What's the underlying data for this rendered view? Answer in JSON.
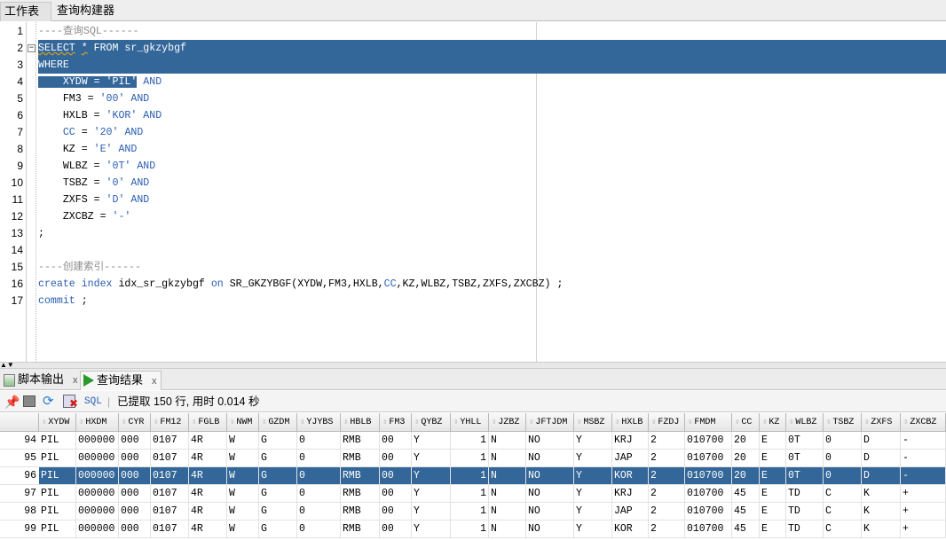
{
  "top_tabs": [
    "工作表",
    "查询构建器"
  ],
  "editor": {
    "lines": [
      {
        "n": "1",
        "tokens": [
          [
            "----查询SQL------",
            "cm"
          ]
        ]
      },
      {
        "n": "2",
        "sel": "full",
        "fold": true,
        "tokens": [
          [
            "SELECT",
            "kw w"
          ],
          [
            " ",
            "tx"
          ],
          [
            "*",
            "tx w"
          ],
          [
            " FROM sr_gkzybgf",
            "kw"
          ]
        ]
      },
      {
        "n": "3",
        "sel": "full",
        "tokens": [
          [
            "WHERE",
            "kw"
          ]
        ]
      },
      {
        "n": "4",
        "tokens": [
          [
            "    XYDW = 'PIL'",
            "tx s"
          ],
          [
            " AND",
            "kw"
          ]
        ]
      },
      {
        "n": "5",
        "tokens": [
          [
            "    FM3 = ",
            "tx"
          ],
          [
            "'00'",
            "st"
          ],
          [
            " AND",
            "kw"
          ]
        ]
      },
      {
        "n": "6",
        "tokens": [
          [
            "    HXLB = ",
            "tx"
          ],
          [
            "'KOR'",
            "st"
          ],
          [
            " AND",
            "kw"
          ]
        ]
      },
      {
        "n": "7",
        "tokens": [
          [
            "    ",
            "tx"
          ],
          [
            "CC",
            "kw"
          ],
          [
            " = ",
            "tx"
          ],
          [
            "'20'",
            "st"
          ],
          [
            " AND",
            "kw"
          ]
        ]
      },
      {
        "n": "8",
        "tokens": [
          [
            "    KZ = ",
            "tx"
          ],
          [
            "'E'",
            "st"
          ],
          [
            " AND",
            "kw"
          ]
        ]
      },
      {
        "n": "9",
        "tokens": [
          [
            "    WLBZ = ",
            "tx"
          ],
          [
            "'0T'",
            "st"
          ],
          [
            " AND",
            "kw"
          ]
        ]
      },
      {
        "n": "10",
        "tokens": [
          [
            "    TSBZ = ",
            "tx"
          ],
          [
            "'0'",
            "st"
          ],
          [
            " AND",
            "kw"
          ]
        ]
      },
      {
        "n": "11",
        "tokens": [
          [
            "    ZXFS = ",
            "tx"
          ],
          [
            "'D'",
            "st"
          ],
          [
            " AND",
            "kw"
          ]
        ]
      },
      {
        "n": "12",
        "tokens": [
          [
            "    ZXCBZ = ",
            "tx"
          ],
          [
            "'-'",
            "st"
          ]
        ]
      },
      {
        "n": "13",
        "tokens": [
          [
            ";",
            "tx"
          ]
        ]
      },
      {
        "n": "14",
        "tokens": []
      },
      {
        "n": "15",
        "tokens": [
          [
            "----创建索引------",
            "cm"
          ]
        ]
      },
      {
        "n": "16",
        "tokens": [
          [
            "create index",
            "kw"
          ],
          [
            " idx_sr_gkzybgf ",
            "tx"
          ],
          [
            "on",
            "kw"
          ],
          [
            " SR_GKZYBGF(XYDW,FM3,HXLB,",
            "tx"
          ],
          [
            "CC",
            "kw"
          ],
          [
            ",KZ,WLBZ,TSBZ,ZXFS,ZXCBZ) ;",
            "tx"
          ]
        ]
      },
      {
        "n": "17",
        "tokens": [
          [
            "commit",
            "kw"
          ],
          [
            " ;",
            "tx"
          ]
        ]
      }
    ]
  },
  "bottom_tabs": [
    {
      "label": "脚本输出",
      "close": "x"
    },
    {
      "label": "查询结果",
      "close": "x"
    }
  ],
  "toolbar": {
    "sql": "SQL",
    "status": "已提取 150 行, 用时 0.014 秒"
  },
  "results": {
    "columns": [
      "XYDW",
      "HXDM",
      "CYR",
      "FM12",
      "FGLB",
      "NWM",
      "GZDM",
      "YJYBS",
      "HBLB",
      "FM3",
      "QYBZ",
      "YHLL",
      "JZBZ",
      "JFTJDM",
      "MSBZ",
      "HXLB",
      "FZDJ",
      "FMDM",
      "CC",
      "KZ",
      "WLBZ",
      "TSBZ",
      "ZXFS",
      "ZXCBZ"
    ],
    "selected_row": "96",
    "rows": [
      {
        "n": "94",
        "v": [
          "PIL",
          "000000",
          "000",
          "0107",
          "4R",
          "W",
          "G",
          "0",
          "RMB",
          "00",
          "Y",
          "1",
          "N",
          "NO",
          "Y",
          "KRJ",
          "2",
          "010700",
          "20",
          "E",
          "0T",
          "0",
          "D",
          "-"
        ]
      },
      {
        "n": "95",
        "v": [
          "PIL",
          "000000",
          "000",
          "0107",
          "4R",
          "W",
          "G",
          "0",
          "RMB",
          "00",
          "Y",
          "1",
          "N",
          "NO",
          "Y",
          "JAP",
          "2",
          "010700",
          "20",
          "E",
          "0T",
          "0",
          "D",
          "-"
        ]
      },
      {
        "n": "96",
        "v": [
          "PIL",
          "000000",
          "000",
          "0107",
          "4R",
          "W",
          "G",
          "0",
          "RMB",
          "00",
          "Y",
          "1",
          "N",
          "NO",
          "Y",
          "KOR",
          "2",
          "010700",
          "20",
          "E",
          "0T",
          "0",
          "D",
          "-"
        ]
      },
      {
        "n": "97",
        "v": [
          "PIL",
          "000000",
          "000",
          "0107",
          "4R",
          "W",
          "G",
          "0",
          "RMB",
          "00",
          "Y",
          "1",
          "N",
          "NO",
          "Y",
          "KRJ",
          "2",
          "010700",
          "45",
          "E",
          "TD",
          "C",
          "K",
          "+"
        ]
      },
      {
        "n": "98",
        "v": [
          "PIL",
          "000000",
          "000",
          "0107",
          "4R",
          "W",
          "G",
          "0",
          "RMB",
          "00",
          "Y",
          "1",
          "N",
          "NO",
          "Y",
          "JAP",
          "2",
          "010700",
          "45",
          "E",
          "TD",
          "C",
          "K",
          "+"
        ]
      },
      {
        "n": "99",
        "v": [
          "PIL",
          "000000",
          "000",
          "0107",
          "4R",
          "W",
          "G",
          "0",
          "RMB",
          "00",
          "Y",
          "1",
          "N",
          "NO",
          "Y",
          "KOR",
          "2",
          "010700",
          "45",
          "E",
          "TD",
          "C",
          "K",
          "+"
        ]
      }
    ]
  }
}
